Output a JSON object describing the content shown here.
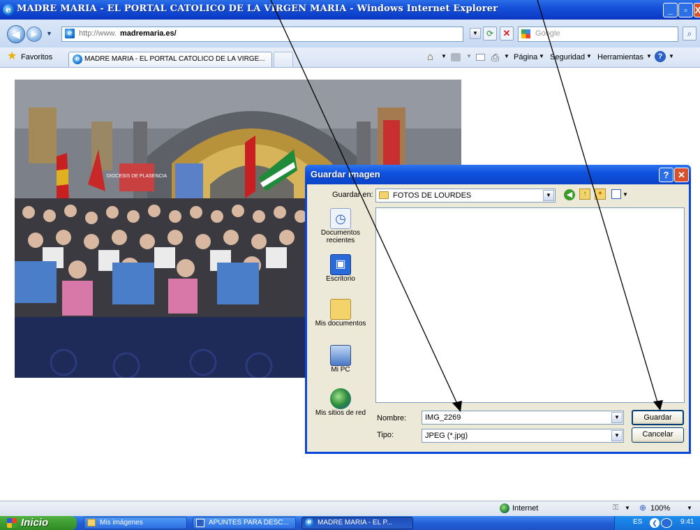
{
  "window": {
    "title": "MADRE MARIA - EL PORTAL CATOLICO DE LA VIRGEN MARIA - Windows Internet Explorer"
  },
  "addressbar": {
    "url_prefix": "http://www.",
    "url_domain": "madremaria.es/",
    "search_placeholder": "Google"
  },
  "favbar": {
    "favorites_label": "Favoritos",
    "tab_label": "MADRE MARIA - EL PORTAL CATOLICO DE LA VIRGE...",
    "pagina": "Página",
    "seguridad": "Seguridad",
    "herramientas": "Herramientas"
  },
  "photo": {
    "banner1": "DIOCESIS DE PLASENCIA"
  },
  "dialog": {
    "title": "Guardar imagen",
    "save_in_label": "Guardar en:",
    "save_in_value": "FOTOS DE LOURDES",
    "places": [
      {
        "label": "Documentos recientes",
        "icon": "recent-documents-icon"
      },
      {
        "label": "Escritorio",
        "icon": "desktop-icon"
      },
      {
        "label": "Mis documentos",
        "icon": "my-documents-icon"
      },
      {
        "label": "Mi PC",
        "icon": "my-computer-icon"
      },
      {
        "label": "Mis sitios de red",
        "icon": "network-places-icon"
      }
    ],
    "name_label": "Nombre:",
    "name_value": "IMG_2269",
    "type_label": "Tipo:",
    "type_value": "JPEG (*.jpg)",
    "save_button": "Guardar",
    "cancel_button": "Cancelar"
  },
  "statusbar": {
    "zone": "Internet",
    "zoom": "100%"
  },
  "taskbar": {
    "start": "Inicio",
    "items": [
      "Mis imágenes",
      "APUNTES PARA DESC...",
      "MADRE MARIA - EL P..."
    ],
    "lang": "ES",
    "time": "9:41"
  },
  "colors": {
    "xp_blue": "#0a46d8",
    "dialog_bg": "#ece9d8",
    "start_green": "#3c9a2c"
  }
}
